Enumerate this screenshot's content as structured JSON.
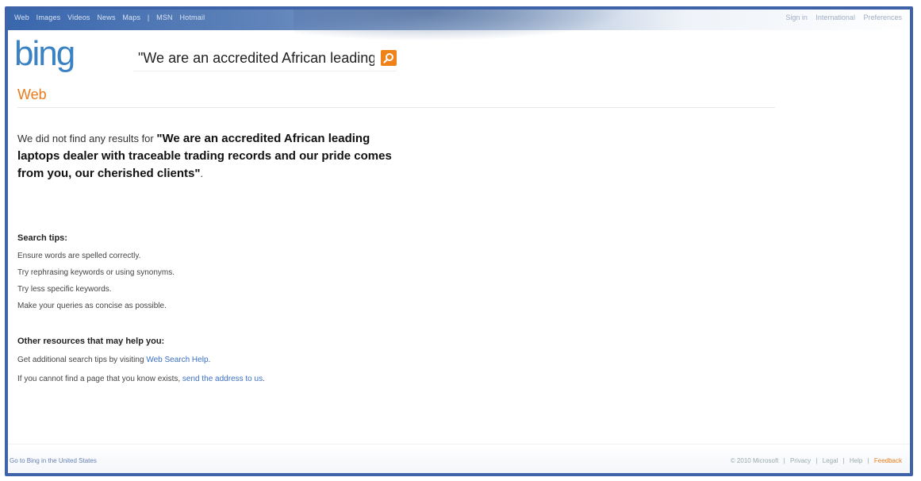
{
  "topbar": {
    "nav": [
      "Web",
      "Images",
      "Videos",
      "News",
      "Maps",
      "|",
      "MSN",
      "Hotmail"
    ],
    "account": [
      "Sign in",
      "International",
      "Preferences"
    ]
  },
  "logo": "bing",
  "search": {
    "value": "\"We are an accredited African leading laptops dealer with traceable trading records and our pride comes from you, our cherished clients\""
  },
  "scope_label": "Web",
  "no_results": {
    "prefix": "We did not find any results for ",
    "query": "\"We are an accredited African leading laptops dealer with traceable trading records and our pride comes from you, our cherished clients\"",
    "suffix": "."
  },
  "search_tips": {
    "heading": "Search tips:",
    "items": [
      "Ensure words are spelled correctly.",
      "Try rephrasing keywords or using synonyms.",
      "Try less specific keywords.",
      "Make your queries as concise as possible."
    ]
  },
  "resources": {
    "heading": "Other resources that may help you:",
    "line1_prefix": "Get additional search tips by visiting ",
    "line1_link": "Web Search Help",
    "line1_suffix": ".",
    "line2_prefix": "If you cannot find a page that you know exists, ",
    "line2_link": "send the address to us",
    "line2_suffix": "."
  },
  "footer": {
    "left": "Go to Bing in the United States",
    "copyright": "© 2010 Microsoft",
    "links": [
      "Privacy",
      "Legal",
      "Help"
    ],
    "feedback": "Feedback"
  },
  "colors": {
    "accent_orange": "#e97b1a",
    "logo_blue": "#3a82c4",
    "link_blue": "#3a6fc4",
    "frame_blue": "#3f63a8"
  },
  "icons": {
    "search_button": "magnifier-icon"
  }
}
